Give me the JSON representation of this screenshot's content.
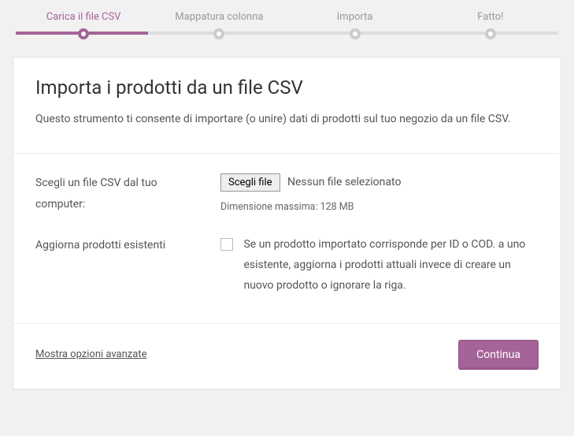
{
  "stepper": {
    "steps": [
      {
        "label": "Carica il file CSV",
        "active": true
      },
      {
        "label": "Mappatura colonna",
        "active": false
      },
      {
        "label": "Importa",
        "active": false
      },
      {
        "label": "Fatto!",
        "active": false
      }
    ]
  },
  "card": {
    "title": "Importa i prodotti da un file CSV",
    "description": "Questo strumento ti consente di importare (o unire) dati di prodotti sul tuo negozio da un file CSV."
  },
  "form": {
    "file_field": {
      "label": "Scegli un file CSV dal tuo computer:",
      "button": "Scegli file",
      "status": "Nessun file selezionato",
      "hint": "Dimensione massima: 128 MB"
    },
    "update_field": {
      "label": "Aggiorna prodotti esistenti",
      "checkbox_text": "Se un prodotto importato corrisponde per ID o COD. a uno esistente, aggiorna i prodotti attuali invece di creare un nuovo prodotto o ignorare la riga."
    }
  },
  "footer": {
    "advanced": "Mostra opzioni avanzate",
    "continue": "Continua"
  }
}
